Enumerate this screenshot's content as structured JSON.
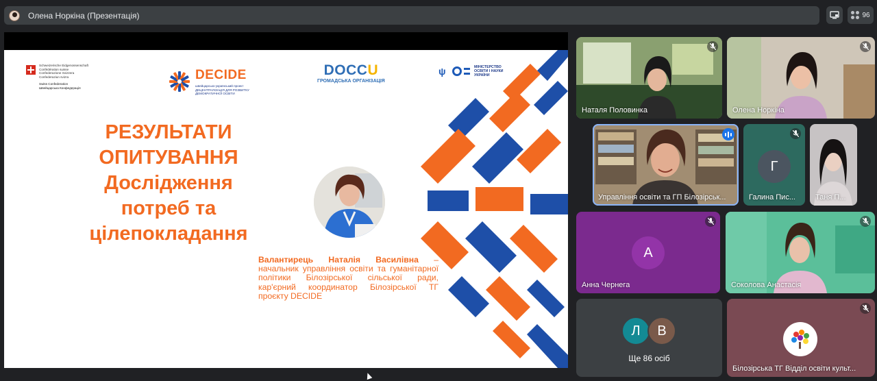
{
  "topbar": {
    "title": "Олена Норкіна (Презентація)",
    "participants_count": "96"
  },
  "slide": {
    "swiss_lines": "Schweizerische Eidgenossenschaft\nConfédération suisse\nConfederazione Svizzera\nConfederaziun svizra",
    "swiss_lines2": "Swiss Confederation\nШвейцарська Конфедерація",
    "decide_name": "DECIDE",
    "decide_sub": "швейцарсько-український проект\nДЕЦЕНТРАЛІЗАЦІЯ ДЛЯ РОЗВИТКУ\nДЕМОКРАТИЧНОЇ ОСВІТИ",
    "doccu_name_1": "DOCC",
    "doccu_name_2": "U",
    "doccu_sub": "ГРОМАДСЬКА ОРГАНІЗАЦІЯ",
    "ministry": "МІНІСТЕРСТВО\nОСВІТИ І НАУКИ\nУКРАЇНИ",
    "headline": [
      "РЕЗУЛЬТАТИ",
      "ОПИТУВАННЯ",
      "Дослідження",
      "потреб та",
      "цілепокладання"
    ],
    "caption_name": "Валантирець Наталія Василівна",
    "caption_rest": " – начальник управління освіти та гуманітарної політики Білозірської сільської ради, кар'єрний координатор Білозірської ТГ проєкту DECIDE"
  },
  "participants": [
    {
      "name": "Наталя Половинка",
      "muted": true
    },
    {
      "name": "Олена Норкіна",
      "muted": true
    },
    {
      "name": "Управління освіти та ГП Білозірськ...",
      "speaking": true
    },
    {
      "name": "Галина Пис...",
      "initial": "Г",
      "muted": true
    },
    {
      "name": "Таня П..."
    },
    {
      "name": "Анна Чернега",
      "initial": "А",
      "muted": true
    },
    {
      "name": "Соколова Анастасія",
      "muted": true
    },
    {
      "name": "Ще 86 осіб",
      "initials": [
        "Л",
        "В"
      ]
    },
    {
      "name": "Білозірська ТГ Відділ освіти культ...",
      "muted": true
    }
  ],
  "colors": {
    "accent_orange": "#f26a21",
    "accent_blue": "#1e4fa8",
    "meet_bg": "#202124",
    "tile_purple": "#7b2a8e"
  },
  "icons": [
    "mic-off-icon",
    "speaking-icon",
    "layout-icon",
    "people-icon"
  ]
}
